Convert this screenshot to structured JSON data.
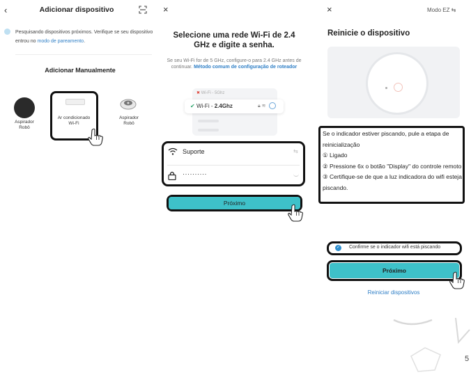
{
  "screen1": {
    "title": "Adicionar dispositivo",
    "back_icon": "‹",
    "scan_icon": "scan-icon",
    "search_text": "Pesquisando dispositivos próximos. Verifique se seu dispositivo entrou no ",
    "search_link": "modo de pareamento",
    "search_end": ".",
    "manual_heading": "Adicionar Manualmente",
    "devices": [
      {
        "label": "Aspirador Robô"
      },
      {
        "label": "Ar condicionado Wi-Fi"
      },
      {
        "label": "Aspirador Robô"
      }
    ]
  },
  "screen2": {
    "close_icon": "×",
    "title": "Selecione uma rede Wi-Fi de 2.4 GHz e digite a senha.",
    "desc": "Se seu Wi-Fi for de 5 GHz, configure-o para 2.4 GHz antes de continuar.",
    "desc_link": "Método comum de configuração de roteador",
    "illustration": {
      "wifi_5": "Wi-Fi - 5Ghz",
      "wifi_24_prefix": "Wi-Fi - ",
      "wifi_24": "2.4Ghz"
    },
    "ssid": "Suporte",
    "password": "··········",
    "next_label": "Próximo"
  },
  "screen3": {
    "close_icon": "×",
    "mode_label": "Modo EZ ⇆",
    "title": "Reinicie o dispositivo",
    "instructions": [
      "Se o indicador estiver piscando, pule a etapa de reinicialização",
      "① Ligado",
      "② Pressione 6x o botão \"Display\" do controle remoto",
      "③ Certifique-se de que a luz indicadora do wifi esteja piscando."
    ],
    "confirm_label": "Confirme se o indicador wifi está piscando",
    "next_label": "Próximo",
    "reset_label": "Reiniciar dispositivos"
  },
  "page_number": "5",
  "colors": {
    "accent": "#3ec1c9",
    "link": "#2f7fc6",
    "highlight_border": "#111111"
  }
}
